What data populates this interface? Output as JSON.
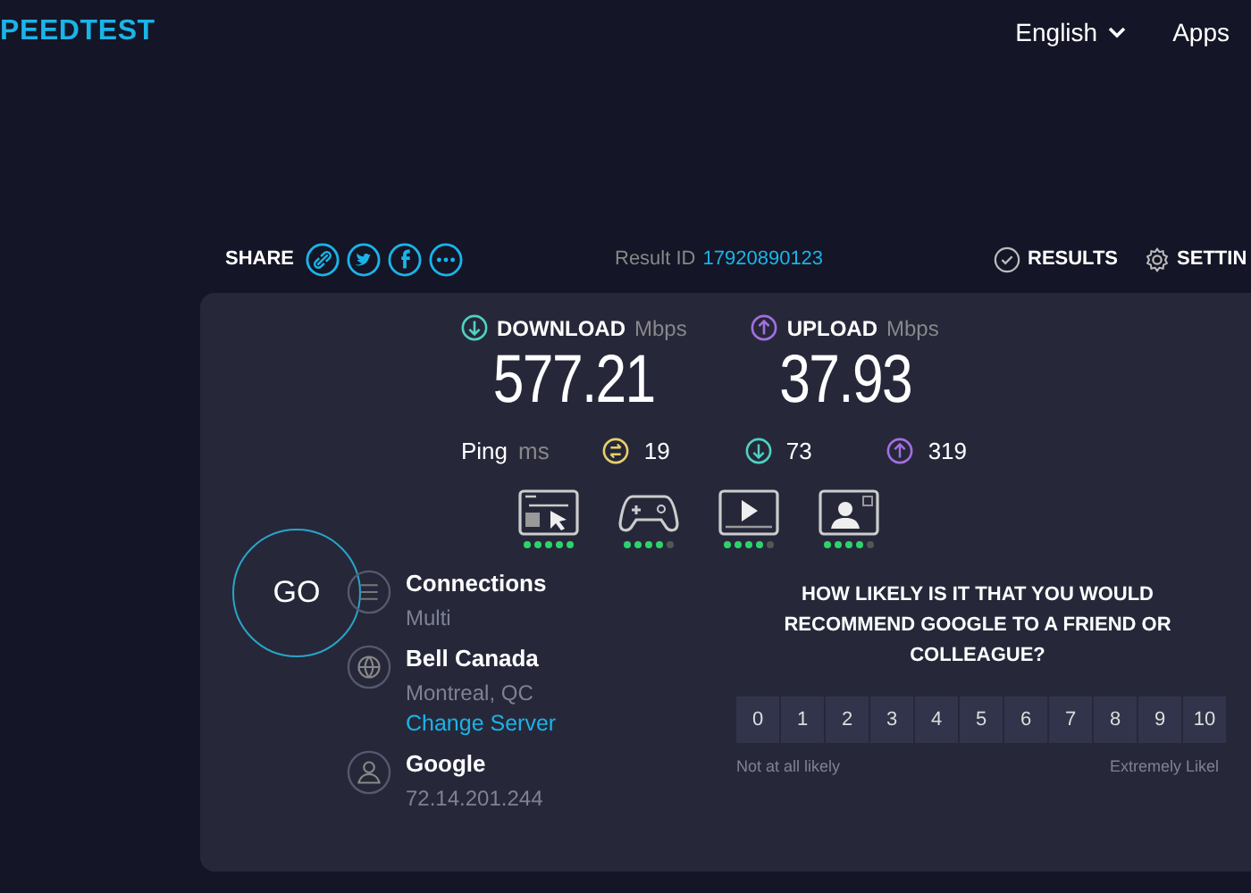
{
  "header": {
    "logo": "PEEDTEST",
    "language": "English",
    "apps": "Apps"
  },
  "share": {
    "label": "SHARE",
    "result_label": "Result ID",
    "result_id": "17920890123",
    "results": "RESULTS",
    "settings": "SETTIN"
  },
  "metrics": [
    {
      "kind": "download",
      "label": "DOWNLOAD",
      "unit": "Mbps",
      "value": "577.21"
    },
    {
      "kind": "upload",
      "label": "UPLOAD",
      "unit": "Mbps",
      "value": "37.93"
    }
  ],
  "ping": {
    "label": "Ping",
    "unit": "ms",
    "items": [
      {
        "kind": "idle",
        "value": "19"
      },
      {
        "kind": "download",
        "value": "73"
      },
      {
        "kind": "upload",
        "value": "319"
      }
    ]
  },
  "quality": [
    {
      "kind": "browsing",
      "stars": 5
    },
    {
      "kind": "gaming",
      "stars": 4
    },
    {
      "kind": "streaming",
      "stars": 4
    },
    {
      "kind": "video-call",
      "stars": 4
    }
  ],
  "go": "GO",
  "info": [
    {
      "kind": "connections",
      "title": "Connections",
      "detail": "Multi"
    },
    {
      "kind": "isp",
      "title": "Bell Canada",
      "detail": "Montreal, QC",
      "link": "Change Server"
    },
    {
      "kind": "host",
      "title": "Google",
      "detail": "72.14.201.244"
    }
  ],
  "survey": {
    "question": "HOW LIKELY IS IT THAT YOU WOULD RECOMMEND GOOGLE TO A FRIEND OR COLLEAGUE?",
    "scale": [
      "0",
      "1",
      "2",
      "3",
      "4",
      "5",
      "6",
      "7",
      "8",
      "9",
      "10"
    ],
    "low": "Not at all likely",
    "high": "Extremely Likel"
  }
}
